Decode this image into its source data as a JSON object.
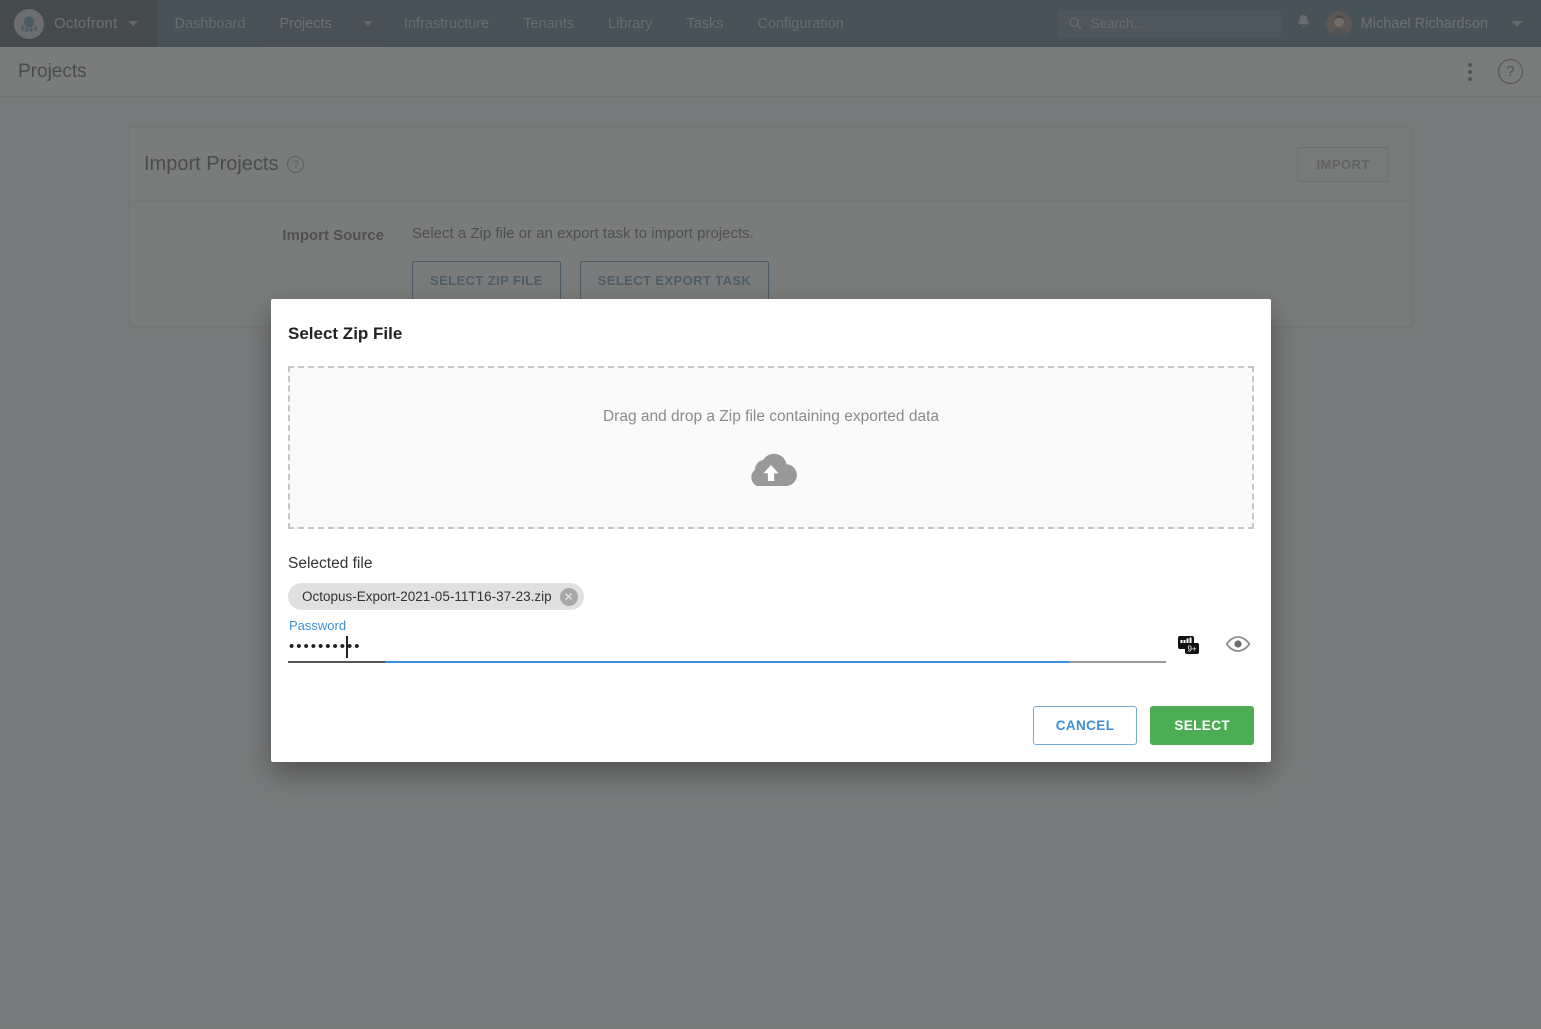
{
  "navbar": {
    "brand": "Octofront",
    "links": [
      {
        "label": "Dashboard",
        "active": false
      },
      {
        "label": "Projects",
        "active": true
      },
      {
        "label": "Infrastructure",
        "active": false
      },
      {
        "label": "Tenants",
        "active": false
      },
      {
        "label": "Library",
        "active": false
      },
      {
        "label": "Tasks",
        "active": false
      },
      {
        "label": "Configuration",
        "active": false
      }
    ],
    "search_placeholder": "Search...",
    "user_name": "Michael Richardson"
  },
  "page": {
    "title": "Projects"
  },
  "card": {
    "title": "Import Projects",
    "import_button": "IMPORT",
    "field_label": "Import Source",
    "field_description": "Select a Zip file or an export task to import projects.",
    "select_zip_button": "SELECT ZIP FILE",
    "select_export_task_button": "SELECT EXPORT TASK"
  },
  "modal": {
    "title": "Select Zip File",
    "dropzone_text": "Drag and drop a Zip file containing exported data",
    "selected_file_label": "Selected file",
    "selected_file_name": "Octopus-Export-2021-05-11T16-37-23.zip",
    "password_label": "Password",
    "password_value": "••••••••••",
    "cancel_button": "CANCEL",
    "select_button": "SELECT"
  },
  "colors": {
    "navbar_bg": "#14425f",
    "navbar_active": "#123a55",
    "brand_bg": "#0c1c27",
    "accent_blue": "#3f8fd8",
    "link_blue": "#2f6f9f",
    "success_green": "#4cad54",
    "overlay_grey": "#7b7c7d"
  }
}
